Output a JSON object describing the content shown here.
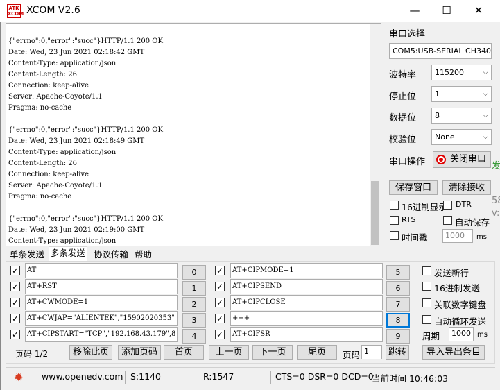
{
  "title": "XCOM V2.6",
  "logo_text": "ATK XCOM",
  "window_controls": {
    "minimize": "—",
    "maximize": "☐",
    "close": "✕"
  },
  "receive_lines": [
    "{\"errno\":0,\"error\":\"succ\"}HTTP/1.1 200 OK",
    "Date: Wed, 23 Jun 2021 02:18:42 GMT",
    "Content-Type: application/json",
    "Content-Length: 26",
    "Connection: keep-alive",
    "Server: Apache-Coyote/1.1",
    "Pragma: no-cache",
    "",
    "{\"errno\":0,\"error\":\"succ\"}HTTP/1.1 200 OK",
    "Date: Wed, 23 Jun 2021 02:18:49 GMT",
    "Content-Type: application/json",
    "Content-Length: 26",
    "Connection: keep-alive",
    "Server: Apache-Coyote/1.1",
    "Pragma: no-cache",
    "",
    "{\"errno\":0,\"error\":\"succ\"}HTTP/1.1 200 OK",
    "Date: Wed, 23 Jun 2021 02:19:00 GMT",
    "Content-Type: application/json"
  ],
  "settings": {
    "port_select_label": "串口选择",
    "port_value": "COM5:USB-SERIAL CH340",
    "baud_label": "波特率",
    "baud_value": "115200",
    "stopbits_label": "停止位",
    "stopbits_value": "1",
    "databits_label": "数据位",
    "databits_value": "8",
    "parity_label": "校验位",
    "parity_value": "None",
    "port_op_label": "串口操作",
    "close_port_label": "关闭串口",
    "save_window_label": "保存窗口",
    "clear_recv_label": "清除接收",
    "hex_display_label": "16进制显示",
    "dtr_label": "DTR",
    "rts_label": "RTS",
    "auto_save_label": "自动保存",
    "timestamp_label": "时间戳",
    "timestamp_value": "1000",
    "timestamp_unit": "ms"
  },
  "tabs": [
    "单条发送",
    "多条发送",
    "协议传输",
    "帮助"
  ],
  "commands_left": [
    {
      "text": "AT",
      "num": "0"
    },
    {
      "text": "AT+RST",
      "num": "1"
    },
    {
      "text": "AT+CWMODE=1",
      "num": "2"
    },
    {
      "text": "AT+CWJAP=\"ALIENTEK\",\"15902020353\"",
      "num": "3"
    },
    {
      "text": "AT+CIPSTART=\"TCP\",\"192.168.43.179\",8",
      "num": "4"
    }
  ],
  "commands_right": [
    {
      "text": "AT+CIPMODE=1",
      "num": "5"
    },
    {
      "text": "AT+CIPSEND",
      "num": "6"
    },
    {
      "text": "AT+CIPCLOSE",
      "num": "7"
    },
    {
      "text": "+++",
      "num": "8"
    },
    {
      "text": "AT+CIFSR",
      "num": "9"
    }
  ],
  "options": {
    "send_newline": "发送新行",
    "hex_send": "16进制发送",
    "link_keypad": "关联数字键盘",
    "auto_loop": "自动循环发送",
    "period_label": "周期",
    "period_value": "1000",
    "period_unit": "ms"
  },
  "pager": {
    "page_label": "页码 1/2",
    "remove_page": "移除此页",
    "add_page": "添加页码",
    "first_page": "首页",
    "prev_page": "上一页",
    "next_page": "下一页",
    "last_page": "尾页",
    "goto_label": "页码",
    "goto_value": "1",
    "jump": "跳转",
    "import_export": "导入导出条目"
  },
  "status": {
    "url": "www.openedv.com",
    "sent": "S:1140",
    "received": "R:1547",
    "signals": "CTS=0 DSR=0 DCD=0",
    "time": "当前时间 10:46:03"
  },
  "edge_chars": [
    "发",
    "58",
    "v:"
  ],
  "colors": {
    "close_indicator": "#e00000",
    "accent": "#0078d7"
  }
}
